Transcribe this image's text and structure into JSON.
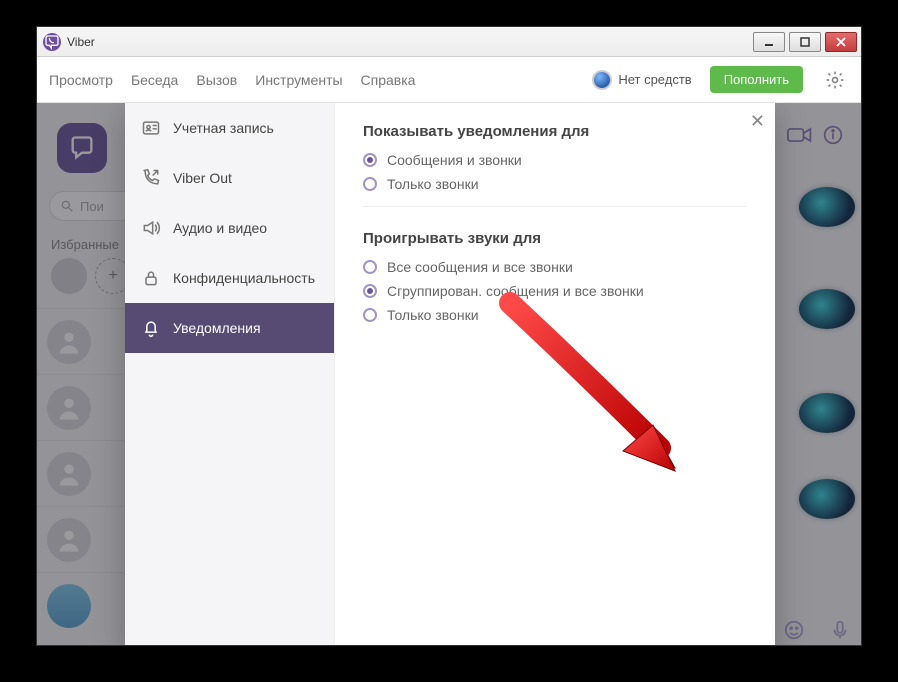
{
  "window": {
    "title": "Viber"
  },
  "menubar": {
    "items": [
      "Просмотр",
      "Беседа",
      "Вызов",
      "Инструменты",
      "Справка"
    ],
    "balance_label": "Нет средств",
    "topup_label": "Пополнить"
  },
  "chat": {
    "search_placeholder": "Пои",
    "favorites_label": "Избранные"
  },
  "settings": {
    "sidebar": {
      "items": [
        {
          "label": "Учетная запись",
          "icon": "id-card-icon"
        },
        {
          "label": "Viber Out",
          "icon": "phone-out-icon"
        },
        {
          "label": "Аудио и видео",
          "icon": "speaker-icon"
        },
        {
          "label": "Конфиденциальность",
          "icon": "lock-icon"
        },
        {
          "label": "Уведомления",
          "icon": "bell-icon"
        }
      ],
      "active_index": 4
    },
    "panel": {
      "section1": {
        "title": "Показывать уведомления для",
        "options": [
          {
            "label": "Сообщения и звонки",
            "checked": true
          },
          {
            "label": "Только звонки",
            "checked": false
          }
        ]
      },
      "section2": {
        "title": "Проигрывать звуки для",
        "options": [
          {
            "label": "Все сообщения и все звонки",
            "checked": false
          },
          {
            "label": "Сгруппирован. сообщения и все звонки",
            "checked": true
          },
          {
            "label": "Только звонки",
            "checked": false
          }
        ]
      }
    }
  }
}
